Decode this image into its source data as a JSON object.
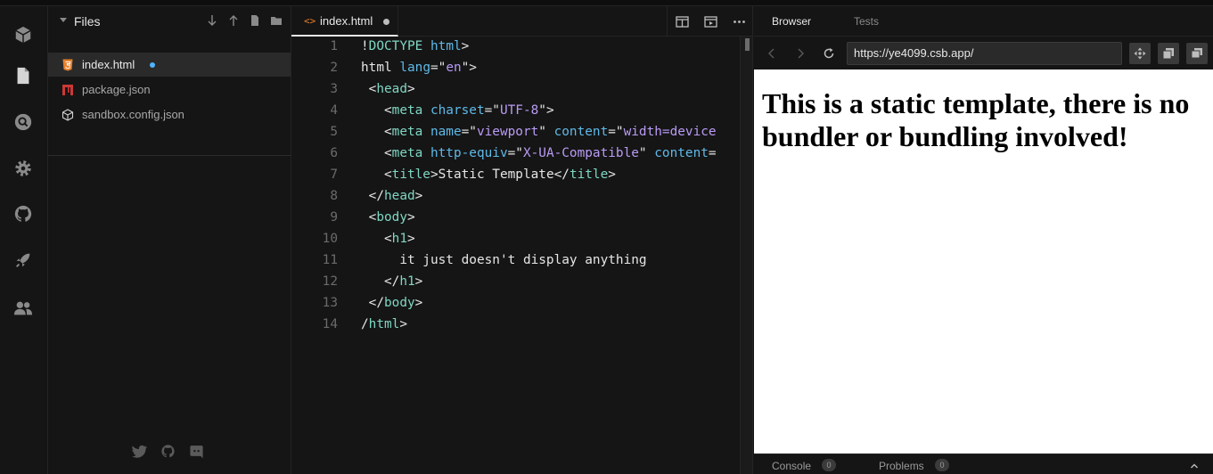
{
  "activity_bar": {
    "items": [
      "cube-icon",
      "file-icon",
      "search-icon",
      "gear-icon",
      "github-icon",
      "rocket-icon",
      "users-icon"
    ]
  },
  "sidebar": {
    "title": "Files",
    "actions": [
      "sort-down-icon",
      "sort-up-icon",
      "new-file-icon",
      "new-folder-icon"
    ],
    "files": [
      {
        "name": "index.html",
        "icon": "html5-icon",
        "active": true,
        "modified": true
      },
      {
        "name": "package.json",
        "icon": "npm-icon",
        "active": false,
        "modified": false
      },
      {
        "name": "sandbox.config.json",
        "icon": "box-icon",
        "active": false,
        "modified": false
      }
    ],
    "social": [
      "twitter-icon",
      "github-icon",
      "discord-icon"
    ]
  },
  "editor": {
    "tab": {
      "icon_text": "<>",
      "label": "index.html",
      "modified": true
    },
    "actions": [
      "split-view-icon",
      "preview-icon",
      "more-icon"
    ],
    "lines": [
      {
        "n": "1",
        "t": [
          [
            "p",
            "!"
          ],
          [
            "tag",
            "DOCTYPE"
          ],
          [
            "p",
            " "
          ],
          [
            "attr",
            "html"
          ],
          [
            "p",
            ">"
          ]
        ]
      },
      {
        "n": "2",
        "t": [
          [
            "p",
            "html "
          ],
          [
            "attr",
            "lang"
          ],
          [
            "p",
            "=\""
          ],
          [
            "str",
            "en"
          ],
          [
            "p",
            "\">"
          ]
        ]
      },
      {
        "n": "3",
        "t": [
          [
            "p",
            " <"
          ],
          [
            "tag",
            "head"
          ],
          [
            "p",
            ">"
          ]
        ]
      },
      {
        "n": "4",
        "t": [
          [
            "p",
            "   <"
          ],
          [
            "tag",
            "meta"
          ],
          [
            "p",
            " "
          ],
          [
            "attr",
            "charset"
          ],
          [
            "p",
            "=\""
          ],
          [
            "str",
            "UTF-8"
          ],
          [
            "p",
            "\">"
          ]
        ]
      },
      {
        "n": "5",
        "t": [
          [
            "p",
            "   <"
          ],
          [
            "tag",
            "meta"
          ],
          [
            "p",
            " "
          ],
          [
            "attr",
            "name"
          ],
          [
            "p",
            "=\""
          ],
          [
            "str",
            "viewport"
          ],
          [
            "p",
            "\" "
          ],
          [
            "attr",
            "content"
          ],
          [
            "p",
            "=\""
          ],
          [
            "str",
            "width=device"
          ]
        ]
      },
      {
        "n": "6",
        "t": [
          [
            "p",
            "   <"
          ],
          [
            "tag",
            "meta"
          ],
          [
            "p",
            " "
          ],
          [
            "attr",
            "http-equiv"
          ],
          [
            "p",
            "=\""
          ],
          [
            "str",
            "X-UA-Compatible"
          ],
          [
            "p",
            "\" "
          ],
          [
            "attr",
            "content"
          ],
          [
            "p",
            "="
          ]
        ]
      },
      {
        "n": "7",
        "t": [
          [
            "p",
            "   <"
          ],
          [
            "tag",
            "title"
          ],
          [
            "p",
            ">Static Template</"
          ],
          [
            "tag",
            "title"
          ],
          [
            "p",
            ">"
          ]
        ]
      },
      {
        "n": "8",
        "t": [
          [
            "p",
            " </"
          ],
          [
            "tag",
            "head"
          ],
          [
            "p",
            ">"
          ]
        ]
      },
      {
        "n": "9",
        "t": [
          [
            "p",
            " <"
          ],
          [
            "tag",
            "body"
          ],
          [
            "p",
            ">"
          ]
        ]
      },
      {
        "n": "10",
        "t": [
          [
            "p",
            "   <"
          ],
          [
            "tag",
            "h1"
          ],
          [
            "p",
            ">"
          ]
        ]
      },
      {
        "n": "11",
        "t": [
          [
            "p",
            "     it just doesn't display anything"
          ]
        ]
      },
      {
        "n": "12",
        "t": [
          [
            "p",
            "   </"
          ],
          [
            "tag",
            "h1"
          ],
          [
            "p",
            ">"
          ]
        ]
      },
      {
        "n": "13",
        "t": [
          [
            "p",
            " </"
          ],
          [
            "tag",
            "body"
          ],
          [
            "p",
            ">"
          ]
        ]
      },
      {
        "n": "14",
        "t": [
          [
            "p",
            "/"
          ],
          [
            "tag",
            "html"
          ],
          [
            "p",
            ">"
          ]
        ]
      }
    ]
  },
  "browser": {
    "tabs": {
      "active": "Browser",
      "inactive": "Tests"
    },
    "url": "https://ye4099.csb.app/",
    "preview_heading": "This is a static template, there is no bundler or bundling involved!",
    "footer": {
      "console_label": "Console",
      "console_count": "0",
      "problems_label": "Problems",
      "problems_count": "0"
    }
  },
  "colors": {
    "background": "#151515",
    "tag": "#7fd6c2",
    "attr": "#5fb9e8",
    "string": "#b99bf4",
    "html_icon": "#e7802d",
    "npm_icon": "#cb3837",
    "modified_dot": "#4fb3ff"
  }
}
